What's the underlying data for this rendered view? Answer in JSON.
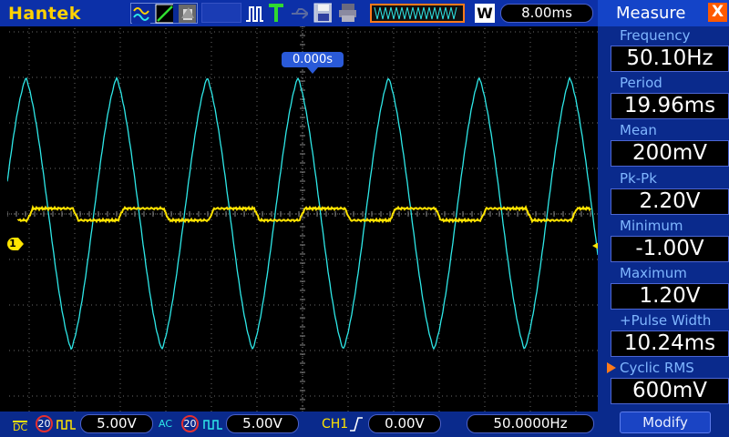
{
  "app": {
    "brand": "Hantek"
  },
  "toolbar": {
    "icons": [
      "math-waveform-icon",
      "cursor-icon",
      "screenshot-icon",
      "trigger-pulse-icon",
      "trigger-t-icon",
      "usb-icon",
      "save-icon",
      "print-icon"
    ],
    "mode": "W",
    "timebase": "8.00ms"
  },
  "screen": {
    "trigger_time": "0.000s",
    "ch1_marker": "1"
  },
  "measure": {
    "title": "Measure",
    "close": "X",
    "items": [
      {
        "label": "Frequency",
        "value": "50.10Hz",
        "selected": false
      },
      {
        "label": "Period",
        "value": "19.96ms",
        "selected": false
      },
      {
        "label": "Mean",
        "value": "200mV",
        "selected": false
      },
      {
        "label": "Pk-Pk",
        "value": "2.20V",
        "selected": false
      },
      {
        "label": "Minimum",
        "value": "-1.00V",
        "selected": false
      },
      {
        "label": "Maximum",
        "value": "1.20V",
        "selected": false
      },
      {
        "label": "+Pulse Width",
        "value": "10.24ms",
        "selected": false
      },
      {
        "label": "Cyclic RMS",
        "value": "600mV",
        "selected": true
      }
    ],
    "modify": "Modify"
  },
  "bottom": {
    "ch1": {
      "coupling": "DC",
      "bw": "20",
      "volts": "5.00V"
    },
    "ch2": {
      "coupling": "AC",
      "bw": "20",
      "volts": "5.00V"
    },
    "trigger": {
      "source": "CH1",
      "level": "0.00V"
    },
    "frequency": "50.0000Hz"
  },
  "colors": {
    "ch1": "#ffe400",
    "ch2": "#2ee8e8",
    "topbar": "#0c30a8",
    "panel": "#0a2a8c",
    "accent": "#ff7a1a"
  }
}
